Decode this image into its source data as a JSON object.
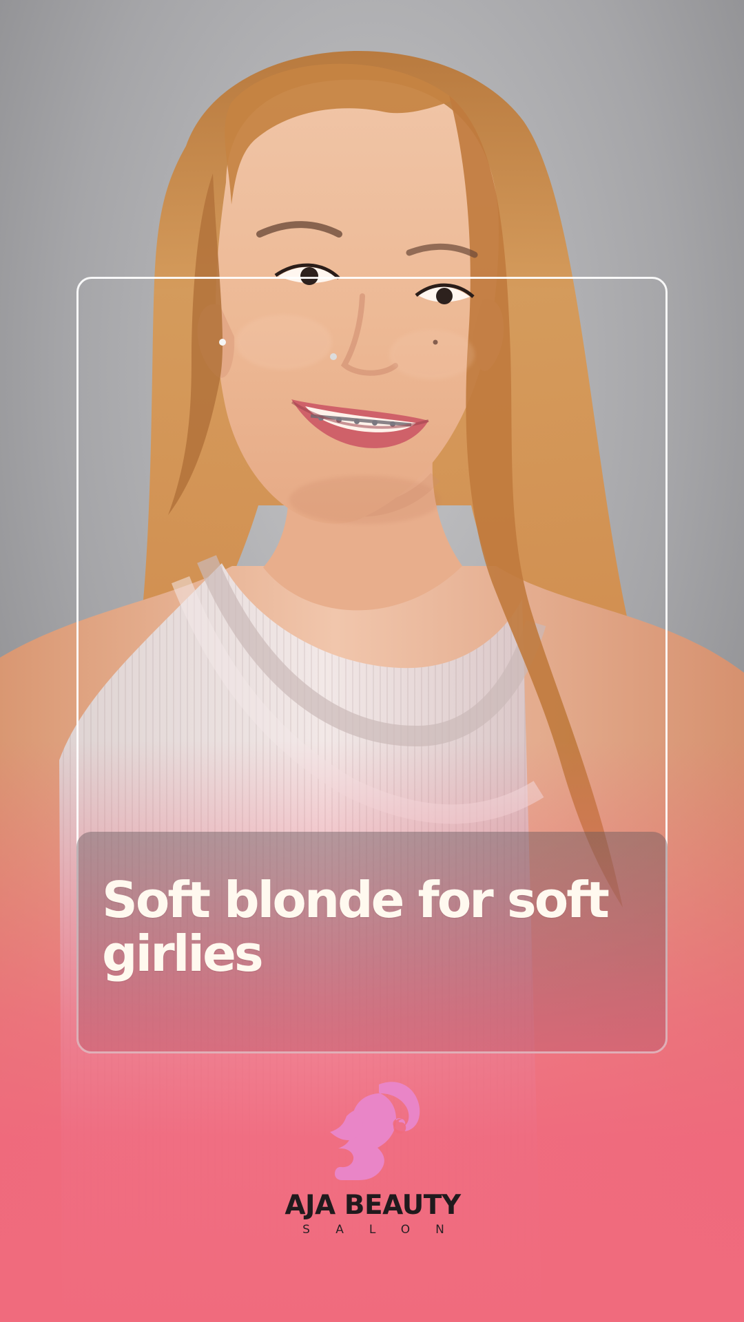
{
  "post": {
    "title": "Soft blonde for soft girlies"
  },
  "brand": {
    "name": "AJA BEAUTY",
    "subtitle": "SALON",
    "logo": "woman-silhouette-ponytail-icon",
    "logo_color": "#e985c7"
  },
  "colors": {
    "background": "#9a9a9d",
    "accent_pink": "#f06b7d",
    "card_outline": "#ffffff",
    "title_text": "#fff9ef"
  }
}
